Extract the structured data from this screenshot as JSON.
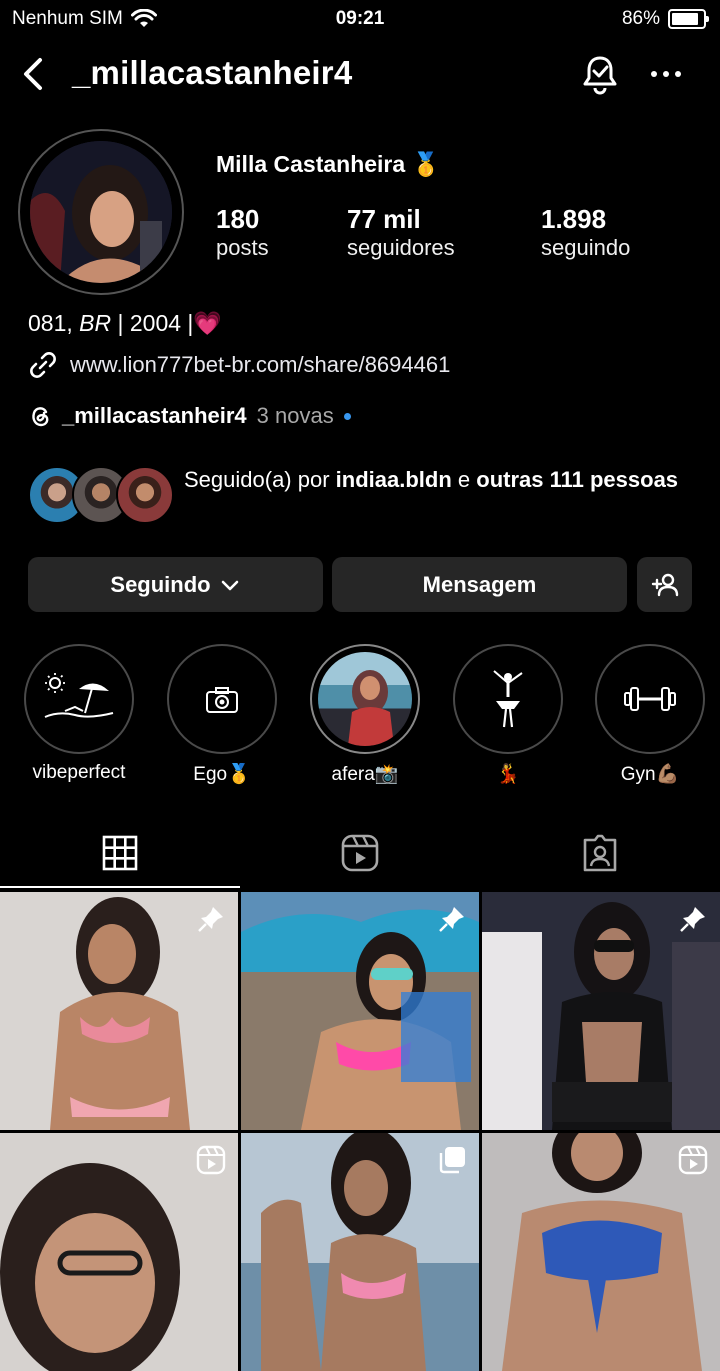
{
  "status_bar": {
    "carrier": "Nenhum SIM",
    "time": "09:21",
    "battery": "86%"
  },
  "header": {
    "username": "_millacastanheir4"
  },
  "profile": {
    "full_name": "Milla Castanheira",
    "name_emoji": "🥇",
    "stats": [
      {
        "value": "180",
        "label": "posts"
      },
      {
        "value": "77 mil",
        "label": "seguidores"
      },
      {
        "value": "1.898",
        "label": "seguindo"
      }
    ],
    "bio_prefix": "081, ",
    "bio_italic": "BR",
    "bio_suffix": " | 2004 |💗",
    "link": "www.lion777bet-br.com/share/8694461",
    "threads_handle": "_millacastanheir4",
    "threads_new": "3 novas",
    "followed_prefix": "Seguido(a) por ",
    "followed_user": "indiaa.bldn",
    "followed_mid": " e ",
    "followed_others": "outras 111 pessoas"
  },
  "actions": {
    "following_label": "Seguindo",
    "message_label": "Mensagem"
  },
  "highlights": [
    {
      "label": "vibeperfect",
      "icon": "beach-umbrella-icon"
    },
    {
      "label": "Ego🥇",
      "icon": "camera-icon"
    },
    {
      "label": "afera📸",
      "icon": "photo-thumbnail"
    },
    {
      "label": "💃",
      "icon": "ballerina-icon"
    },
    {
      "label": "Gyn💪🏽",
      "icon": "dumbbell-icon"
    }
  ],
  "tabs": [
    {
      "name": "posts-grid",
      "icon": "grid-icon",
      "active": true
    },
    {
      "name": "reels",
      "icon": "reels-icon",
      "active": false
    },
    {
      "name": "tagged",
      "icon": "tagged-icon",
      "active": false
    }
  ],
  "posts": [
    {
      "badge": "pin-icon",
      "colors": [
        "#d9d5d2",
        "#b58466"
      ]
    },
    {
      "badge": "pin-icon",
      "colors": [
        "#5c8fb8",
        "#c89470"
      ]
    },
    {
      "badge": "pin-icon",
      "colors": [
        "#2a2c3a",
        "#6c5a7a"
      ]
    },
    {
      "badge": "reels-icon",
      "colors": [
        "#d6d2cf",
        "#8a6a58"
      ]
    },
    {
      "badge": "carousel-icon",
      "colors": [
        "#b7c6d3",
        "#a67a60"
      ]
    },
    {
      "badge": "reels-icon",
      "colors": [
        "#bfbcbc",
        "#2e59b8"
      ]
    }
  ],
  "colors": {
    "accent_blue": "#3897f0",
    "button_bg": "#262626"
  }
}
